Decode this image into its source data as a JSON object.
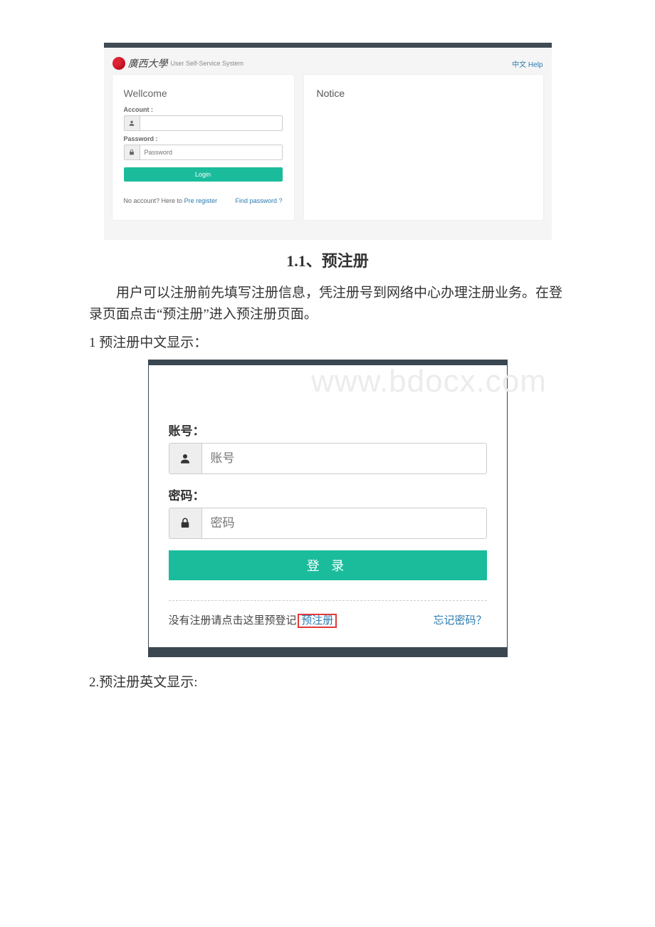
{
  "figure1": {
    "header": {
      "university_script": "廣西大學",
      "system_title": "User Self-Service System",
      "links": {
        "lang": "中文",
        "help": "Help"
      }
    },
    "login": {
      "title": "Wellcome",
      "account_label": "Account :",
      "account_placeholder": "",
      "password_label": "Password :",
      "password_placeholder": "Password",
      "login_btn": "Login",
      "no_account_text": "No account? Here to ",
      "pre_register_link": "Pre register",
      "find_password_link": "Find password ?"
    },
    "notice": {
      "title": "Notice"
    }
  },
  "section": {
    "heading": "1.1、预注册",
    "body": "用户可以注册前先填写注册信息，凭注册号到网络中心办理注册业务。在登录页面点击“预注册”进入预注册页面。",
    "item1": "1 预注册中文显示：",
    "item2": "2.预注册英文显示:"
  },
  "figure2": {
    "watermark": "www.bdocx.com",
    "account_label": "账号：",
    "account_placeholder": "账号",
    "password_label": "密码：",
    "password_placeholder": "密码",
    "login_btn": "登 录",
    "no_account_text": "没有注册请点击这里预登记",
    "pre_register_link": "预注册",
    "forgot_link": "忘记密码？"
  }
}
